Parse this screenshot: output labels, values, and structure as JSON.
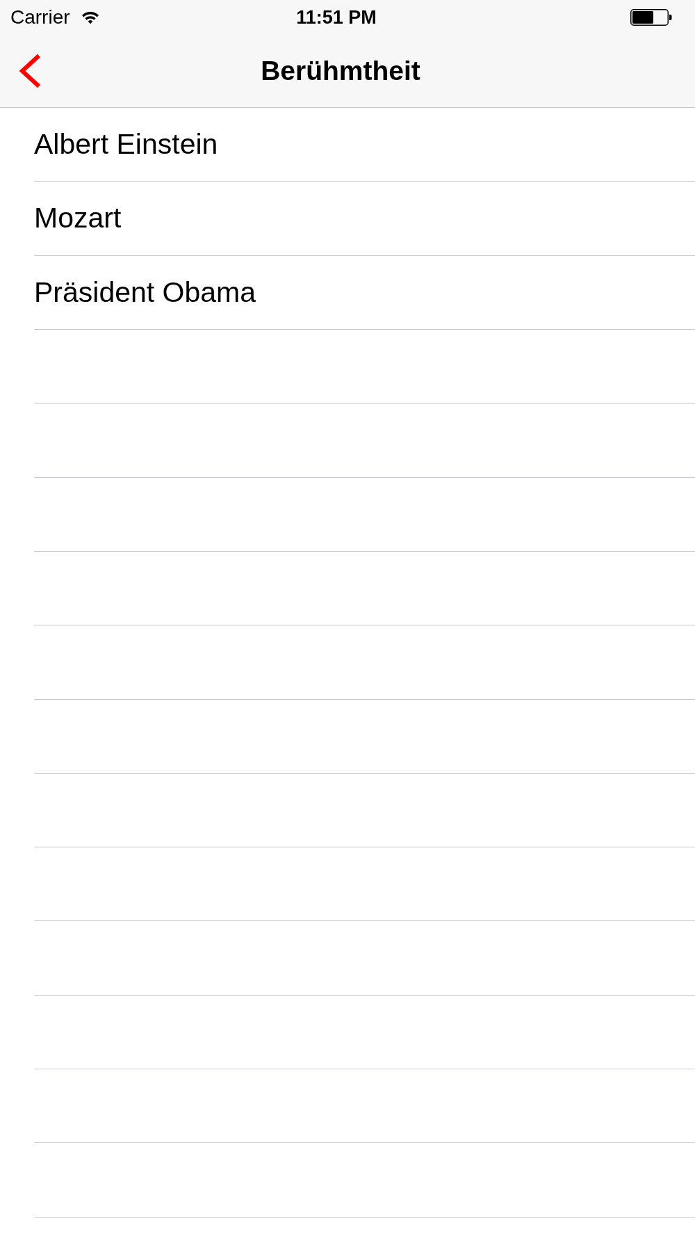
{
  "status_bar": {
    "carrier": "Carrier",
    "time": "11:51 PM"
  },
  "nav_bar": {
    "title": "Berühmtheit"
  },
  "list": {
    "items": [
      {
        "label": "Albert Einstein"
      },
      {
        "label": "Mozart"
      },
      {
        "label": "Präsident Obama"
      }
    ]
  }
}
